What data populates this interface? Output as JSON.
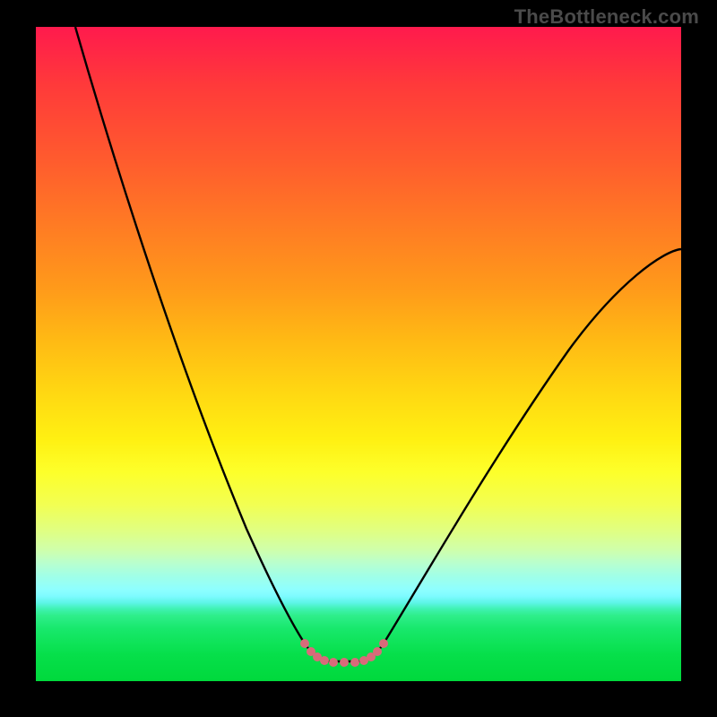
{
  "watermark": "TheBottleneck.com",
  "chart_data": {
    "type": "line",
    "title": "",
    "xlabel": "",
    "ylabel": "",
    "xlim": [
      0,
      100
    ],
    "ylim": [
      0,
      100
    ],
    "grid": false,
    "legend": false,
    "series": [
      {
        "name": "bottleneck-curve",
        "x": [
          5,
          10,
          15,
          20,
          25,
          30,
          35,
          38,
          40,
          42,
          44,
          46,
          48,
          50,
          55,
          60,
          65,
          70,
          75,
          80,
          85,
          90,
          95,
          100
        ],
        "values": [
          100,
          86,
          73,
          60,
          47,
          34,
          21,
          13,
          8,
          4,
          2,
          1,
          1,
          2,
          5,
          10,
          17,
          25,
          33,
          41,
          49,
          56,
          61,
          65
        ]
      }
    ],
    "annotations": [
      {
        "name": "minimum-dots",
        "x_range": [
          40,
          50
        ],
        "y_approx": 1
      }
    ],
    "background_gradient": {
      "orientation": "vertical",
      "stops": [
        {
          "pos": 0,
          "color": "#ff1a4d"
        },
        {
          "pos": 50,
          "color": "#ffd812"
        },
        {
          "pos": 70,
          "color": "#fdff2a"
        },
        {
          "pos": 100,
          "color": "#00d93c"
        }
      ]
    }
  }
}
